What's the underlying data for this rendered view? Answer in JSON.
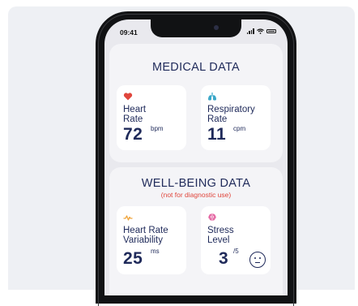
{
  "status_bar": {
    "time": "09:41"
  },
  "medical": {
    "title": "MEDICAL DATA",
    "heart_rate": {
      "label_line1": "Heart",
      "label_line2": "Rate",
      "value": "72",
      "unit": "bpm",
      "icon": "heart-icon"
    },
    "respiratory_rate": {
      "label_line1": "Respiratory",
      "label_line2": "Rate",
      "value": "11",
      "unit": "cpm",
      "icon": "lungs-icon"
    }
  },
  "wellbeing": {
    "title": "WELL-BEING DATA",
    "subtitle": "(not for diagnostic use)",
    "hrv": {
      "label_line1": "Heart Rate",
      "label_line2": "Variability",
      "value": "25",
      "unit": "ms",
      "icon": "pulse-wave-icon"
    },
    "stress": {
      "label_line1": "Stress",
      "label_line2": "Level",
      "value": "3",
      "scale": "/5",
      "icon": "brain-icon",
      "mood_icon": "neutral-face-icon"
    }
  },
  "colors": {
    "heading": "#1f2a5a",
    "heart": "#e0463c",
    "lungs": "#3aa7c8",
    "pulse": "#f0a43a",
    "brain": "#e56aa5",
    "warning": "#e0463c"
  }
}
